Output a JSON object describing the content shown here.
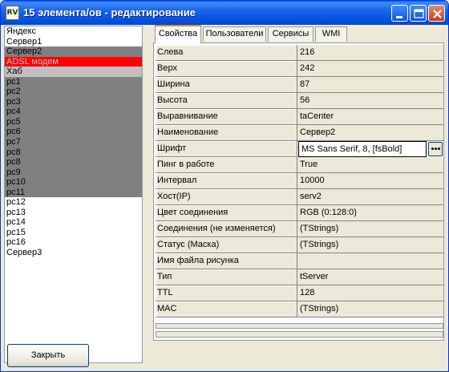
{
  "window": {
    "title": "15 элемента/ов - редактирование",
    "icon_text": "RV"
  },
  "list": {
    "items": [
      {
        "label": "Яндекс",
        "state": "normal"
      },
      {
        "label": "Сервер1",
        "state": "normal"
      },
      {
        "label": "Сервер2",
        "state": "selected"
      },
      {
        "label": "ADSL модем",
        "state": "red"
      },
      {
        "label": "Хаб",
        "state": "light"
      },
      {
        "label": "pc1",
        "state": "selected"
      },
      {
        "label": "pc2",
        "state": "selected"
      },
      {
        "label": "pc3",
        "state": "selected"
      },
      {
        "label": "pc4",
        "state": "selected"
      },
      {
        "label": "pc5",
        "state": "selected"
      },
      {
        "label": "pc6",
        "state": "selected"
      },
      {
        "label": "pc7",
        "state": "selected"
      },
      {
        "label": "pc8",
        "state": "selected"
      },
      {
        "label": "pc8",
        "state": "selected"
      },
      {
        "label": "pc9",
        "state": "selected"
      },
      {
        "label": "pc10",
        "state": "selected"
      },
      {
        "label": "pc11",
        "state": "selected"
      },
      {
        "label": "pc12",
        "state": "normal"
      },
      {
        "label": "pc13",
        "state": "normal"
      },
      {
        "label": "pc14",
        "state": "normal"
      },
      {
        "label": "pc15",
        "state": "normal"
      },
      {
        "label": "pc16",
        "state": "normal"
      },
      {
        "label": "Сервер3",
        "state": "normal"
      }
    ]
  },
  "tabs": [
    {
      "label": "Свойства",
      "active": true
    },
    {
      "label": "Пользователи",
      "active": false
    },
    {
      "label": "Сервисы",
      "active": false
    },
    {
      "label": "WMI",
      "active": false
    }
  ],
  "properties": [
    {
      "name": "Слева",
      "value": "216"
    },
    {
      "name": "Верх",
      "value": "242"
    },
    {
      "name": "Ширина",
      "value": "87"
    },
    {
      "name": "Высота",
      "value": "56"
    },
    {
      "name": "Выравнивание",
      "value": "taCenter"
    },
    {
      "name": "Наименование",
      "value": "Сервер2"
    },
    {
      "name": "Шрифт",
      "value": "MS Sans Serif, 8, [fsBold]"
    },
    {
      "name": "Пинг в работе",
      "value": "True"
    },
    {
      "name": "Интервал",
      "value": "10000"
    },
    {
      "name": "Хост(IP)",
      "value": "serv2"
    },
    {
      "name": "Цвет соединения",
      "value": "RGB (0:128:0)"
    },
    {
      "name": "Соединения (не изменяется)",
      "value": "(TStrings)"
    },
    {
      "name": "Статус (Маска)",
      "value": "(TStrings)"
    },
    {
      "name": "Имя файла рисунка",
      "value": ""
    },
    {
      "name": "Тип",
      "value": "tServer"
    },
    {
      "name": "TTL",
      "value": "128"
    },
    {
      "name": "MAC",
      "value": "(TStrings)"
    }
  ],
  "footer": {
    "close_label": "Закрыть"
  },
  "icons": {
    "minimize": "minimize-icon",
    "maximize": "maximize-icon",
    "close": "close-icon",
    "ellipsis": "ellipsis-icon"
  },
  "colors": {
    "title_bar": "#0053e1",
    "selection": "#808080",
    "highlight_red": "#ff0000"
  }
}
